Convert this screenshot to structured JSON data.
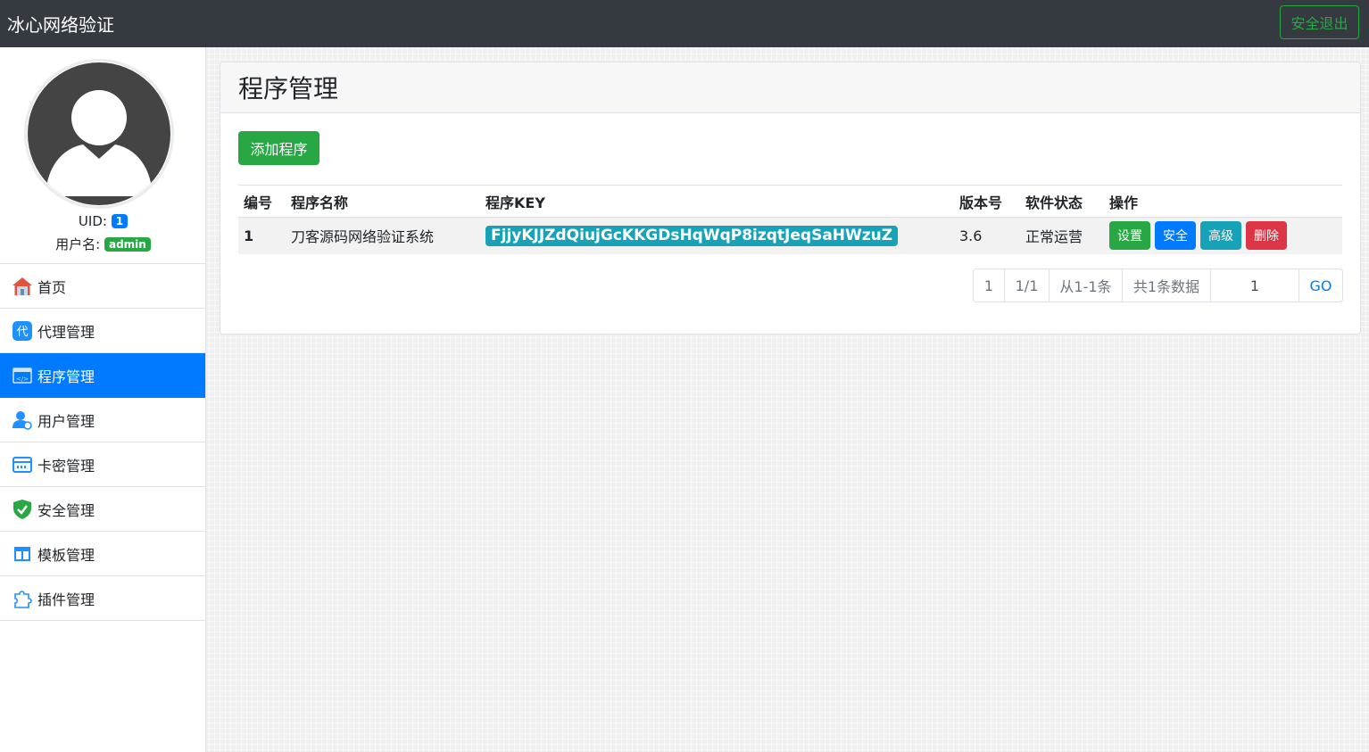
{
  "header": {
    "brand": "冰心网络验证",
    "logout_label": "安全退出"
  },
  "sidebar": {
    "uid_label": "UID:",
    "uid_value": "1",
    "username_label": "用户名:",
    "username_value": "admin",
    "items": [
      {
        "label": "首页",
        "icon": "home-icon"
      },
      {
        "label": "代理管理",
        "icon": "agent-icon"
      },
      {
        "label": "程序管理",
        "icon": "program-icon",
        "active": true
      },
      {
        "label": "用户管理",
        "icon": "user-icon"
      },
      {
        "label": "卡密管理",
        "icon": "card-icon"
      },
      {
        "label": "安全管理",
        "icon": "shield-check-icon"
      },
      {
        "label": "模板管理",
        "icon": "template-icon"
      },
      {
        "label": "插件管理",
        "icon": "puzzle-icon"
      }
    ]
  },
  "main": {
    "title": "程序管理",
    "add_button": "添加程序",
    "table": {
      "headers": [
        "编号",
        "程序名称",
        "程序KEY",
        "版本号",
        "软件状态",
        "操作"
      ],
      "rows": [
        {
          "id": "1",
          "name": "刀客源码网络验证系统",
          "key": "FjjyKJJZdQiujGcKKGDsHqWqP8izqtJeqSaHWzuZ",
          "version": "3.6",
          "status": "正常运营",
          "actions": [
            "设置",
            "安全",
            "高级",
            "删除"
          ]
        }
      ]
    },
    "pager": {
      "page": "1",
      "page_of": "1/1",
      "range": "从1-1条",
      "total": "共1条数据",
      "input_value": "1",
      "go_label": "GO"
    }
  },
  "colors": {
    "topbar": "#343a40",
    "primary": "#007bff",
    "success": "#28a745",
    "info": "#17a2b8",
    "danger": "#dc3545"
  }
}
